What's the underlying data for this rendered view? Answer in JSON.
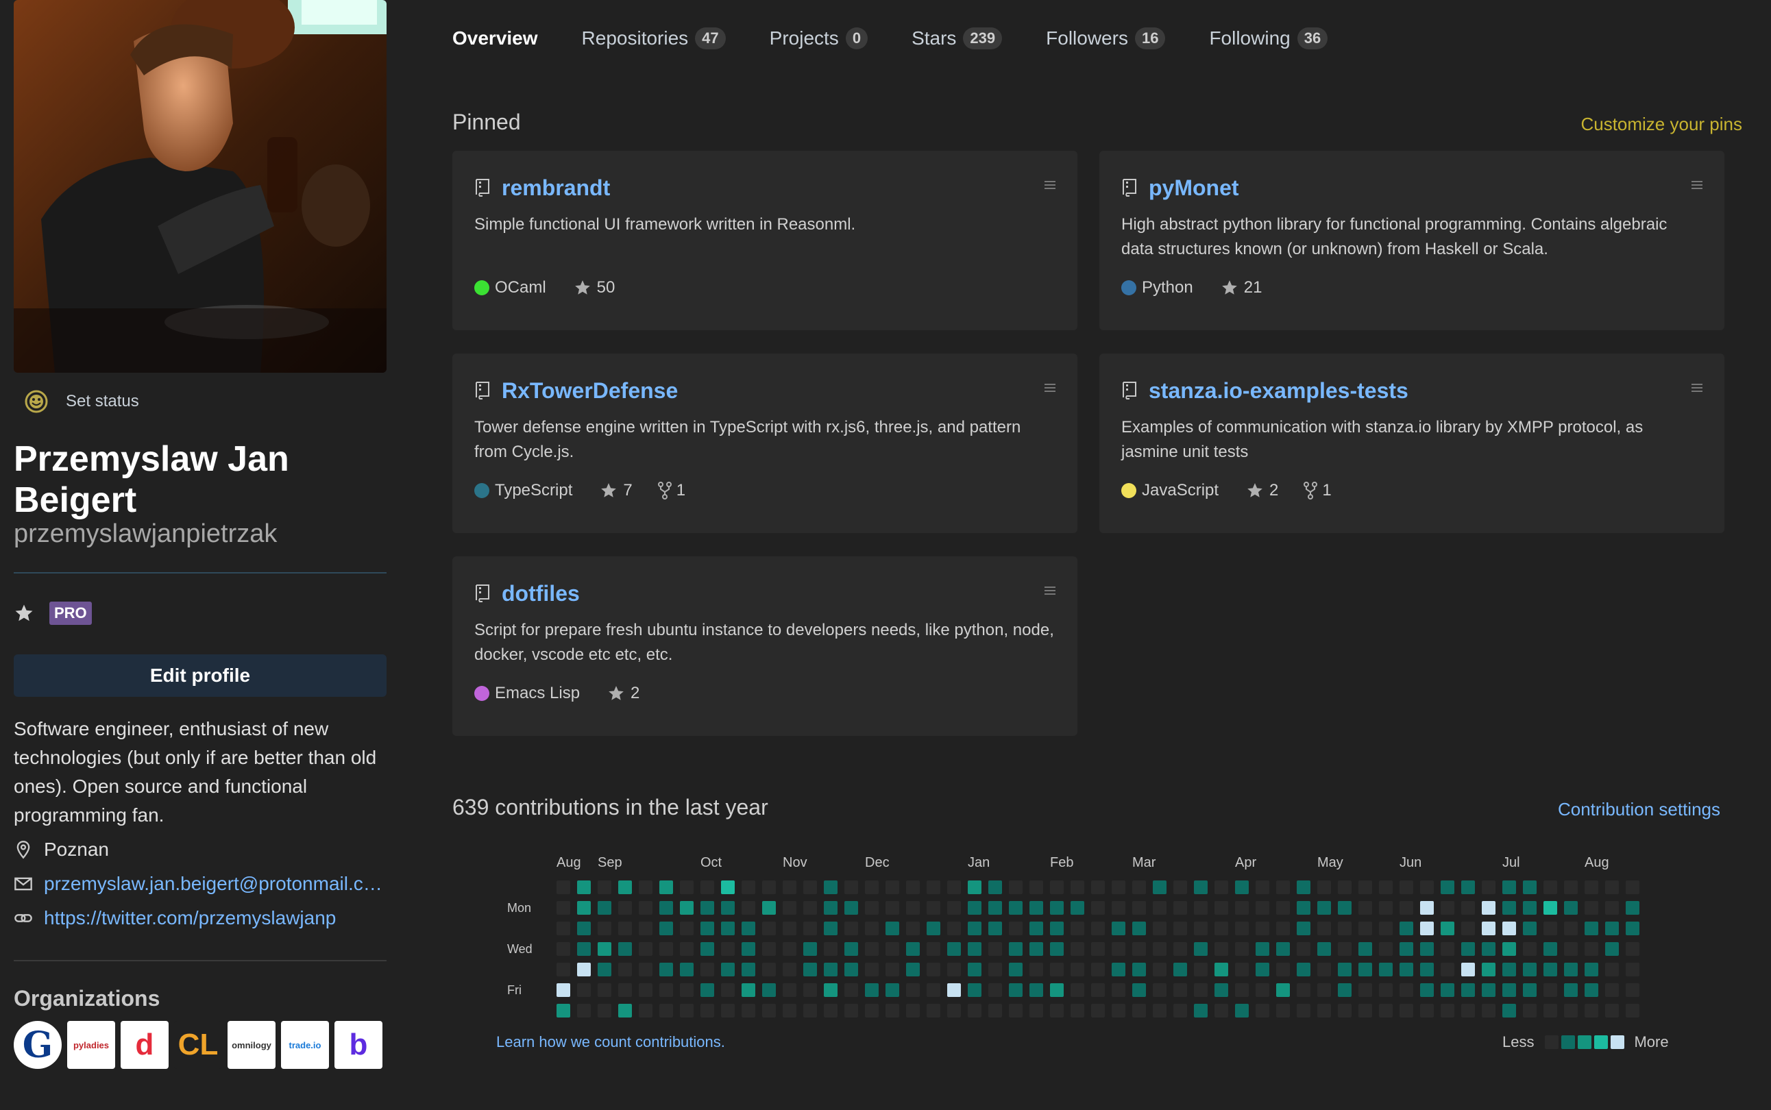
{
  "profile": {
    "set_status": "Set status",
    "full_name": "Przemyslaw Jan Beigert",
    "username": "przemyslawjanpietrzak",
    "pro_label": "PRO",
    "edit_profile": "Edit profile",
    "bio": "Software engineer, enthusiast of new technologies (but only if are better than old ones). Open source and functional programming fan.",
    "location": "Poznan",
    "email": "przemyslaw.jan.beigert@protonmail.com",
    "website": "https://twitter.com/przemyslawjanp"
  },
  "organizations": {
    "title": "Organizations",
    "items": [
      {
        "name": "G",
        "bg": "#ffffff",
        "fg": "#0b3a8a"
      },
      {
        "name": "pyladies",
        "bg": "#ffffff",
        "fg": "#c0262c"
      },
      {
        "name": "d",
        "bg": "#ffffff",
        "fg": "#e52b3b"
      },
      {
        "name": "CL",
        "bg": "#212121",
        "fg": "#f0a42a"
      },
      {
        "name": "omnilogy",
        "bg": "#ffffff",
        "fg": "#333333"
      },
      {
        "name": "trade.io",
        "bg": "#ffffff",
        "fg": "#1a7ad8"
      },
      {
        "name": "b",
        "bg": "#ffffff",
        "fg": "#5d2be0"
      }
    ]
  },
  "tabs": [
    {
      "label": "Overview",
      "count": null,
      "active": true
    },
    {
      "label": "Repositories",
      "count": "47"
    },
    {
      "label": "Projects",
      "count": "0"
    },
    {
      "label": "Stars",
      "count": "239"
    },
    {
      "label": "Followers",
      "count": "16"
    },
    {
      "label": "Following",
      "count": "36"
    }
  ],
  "pinned": {
    "title": "Pinned",
    "customize": "Customize your pins",
    "repos": [
      {
        "name": "rembrandt",
        "desc": "Simple functional UI framework written in Reasonml.",
        "lang": "OCaml",
        "lang_color": "#3be133",
        "stars": "50",
        "forks": null
      },
      {
        "name": "pyMonet",
        "desc": "High abstract python library for functional programming. Contains algebraic data structures known (or unknown) from Haskell or Scala.",
        "lang": "Python",
        "lang_color": "#3572A5",
        "stars": "21",
        "forks": null
      },
      {
        "name": "RxTowerDefense",
        "desc": "Tower defense engine written in TypeScript with rx.js6, three.js, and pattern from Cycle.js.",
        "lang": "TypeScript",
        "lang_color": "#2b7489",
        "stars": "7",
        "forks": "1"
      },
      {
        "name": "stanza.io-examples-tests",
        "desc": "Examples of communication with stanza.io library by XMPP protocol, as jasmine unit tests",
        "lang": "JavaScript",
        "lang_color": "#f1e05a",
        "stars": "2",
        "forks": "1"
      },
      {
        "name": "dotfiles",
        "desc": "Script for prepare fresh ubuntu instance to developers needs, like python, node, docker, vscode etc etc, etc.",
        "lang": "Emacs Lisp",
        "lang_color": "#c065db",
        "stars": "2",
        "forks": null
      }
    ]
  },
  "contributions": {
    "title": "639 contributions in the last year",
    "settings": "Contribution settings",
    "learn": "Learn how we count contributions.",
    "less": "Less",
    "more": "More",
    "months": [
      {
        "label": "Aug",
        "week": 0
      },
      {
        "label": "Sep",
        "week": 2
      },
      {
        "label": "Oct",
        "week": 7
      },
      {
        "label": "Nov",
        "week": 11
      },
      {
        "label": "Dec",
        "week": 15
      },
      {
        "label": "Jan",
        "week": 20
      },
      {
        "label": "Feb",
        "week": 24
      },
      {
        "label": "Mar",
        "week": 28
      },
      {
        "label": "Apr",
        "week": 33
      },
      {
        "label": "May",
        "week": 37
      },
      {
        "label": "Jun",
        "week": 41
      },
      {
        "label": "Jul",
        "week": 46
      },
      {
        "label": "Aug",
        "week": 50
      }
    ],
    "day_labels": [
      {
        "label": "Mon",
        "row": 1
      },
      {
        "label": "Wed",
        "row": 3
      },
      {
        "label": "Fri",
        "row": 5
      }
    ],
    "level_colors": [
      "#2b2b2b",
      "#0e6e64",
      "#14957f",
      "#1cbca0",
      "#c8e2f2"
    ],
    "weeks": [
      [
        0,
        0,
        0,
        0,
        0,
        4,
        2
      ],
      [
        2,
        2,
        1,
        1,
        4,
        0,
        0
      ],
      [
        0,
        1,
        0,
        2,
        1,
        0,
        0
      ],
      [
        2,
        0,
        0,
        1,
        0,
        0,
        2
      ],
      [
        0,
        0,
        0,
        0,
        0,
        0,
        0
      ],
      [
        2,
        1,
        1,
        0,
        1,
        0,
        0
      ],
      [
        0,
        2,
        0,
        0,
        1,
        0,
        0
      ],
      [
        0,
        1,
        1,
        1,
        0,
        1,
        0
      ],
      [
        3,
        1,
        1,
        0,
        1,
        0,
        0
      ],
      [
        0,
        0,
        1,
        1,
        1,
        2,
        0
      ],
      [
        0,
        2,
        0,
        0,
        0,
        1,
        0
      ],
      [
        0,
        0,
        0,
        0,
        0,
        0,
        0
      ],
      [
        0,
        0,
        0,
        1,
        1,
        0,
        0
      ],
      [
        1,
        1,
        1,
        0,
        1,
        2,
        0
      ],
      [
        0,
        1,
        0,
        1,
        1,
        0,
        0
      ],
      [
        0,
        0,
        0,
        0,
        0,
        1,
        0
      ],
      [
        0,
        0,
        1,
        0,
        0,
        1,
        0
      ],
      [
        0,
        0,
        0,
        1,
        1,
        0,
        0
      ],
      [
        0,
        0,
        1,
        0,
        0,
        0,
        0
      ],
      [
        0,
        0,
        0,
        1,
        0,
        4,
        0
      ],
      [
        2,
        1,
        1,
        1,
        1,
        1,
        0
      ],
      [
        1,
        1,
        1,
        0,
        0,
        0,
        0
      ],
      [
        0,
        1,
        0,
        1,
        1,
        1,
        0
      ],
      [
        0,
        1,
        1,
        1,
        0,
        1,
        0
      ],
      [
        0,
        1,
        1,
        1,
        0,
        2,
        0
      ],
      [
        0,
        1,
        0,
        0,
        0,
        0,
        0
      ],
      [
        0,
        0,
        0,
        0,
        0,
        0,
        0
      ],
      [
        0,
        0,
        1,
        0,
        1,
        0,
        0
      ],
      [
        0,
        0,
        1,
        0,
        1,
        1,
        0
      ],
      [
        1,
        0,
        0,
        0,
        0,
        0,
        0
      ],
      [
        0,
        0,
        0,
        0,
        1,
        0,
        0
      ],
      [
        1,
        0,
        0,
        1,
        0,
        0,
        1
      ],
      [
        0,
        0,
        0,
        0,
        2,
        1,
        0
      ],
      [
        1,
        0,
        0,
        0,
        0,
        0,
        1
      ],
      [
        0,
        0,
        0,
        1,
        1,
        0,
        0
      ],
      [
        0,
        0,
        0,
        1,
        0,
        2,
        0
      ],
      [
        1,
        1,
        1,
        0,
        1,
        0,
        0
      ],
      [
        0,
        1,
        0,
        1,
        0,
        0,
        0
      ],
      [
        0,
        1,
        0,
        0,
        1,
        1,
        0
      ],
      [
        0,
        0,
        0,
        1,
        1,
        0,
        0
      ],
      [
        0,
        0,
        0,
        0,
        1,
        0,
        0
      ],
      [
        0,
        0,
        1,
        1,
        1,
        0,
        0
      ],
      [
        0,
        4,
        4,
        1,
        1,
        1,
        0
      ],
      [
        1,
        0,
        2,
        0,
        0,
        1,
        0
      ],
      [
        1,
        0,
        0,
        1,
        4,
        1,
        0
      ],
      [
        0,
        4,
        4,
        1,
        2,
        1,
        0
      ],
      [
        1,
        1,
        4,
        2,
        1,
        1,
        1
      ],
      [
        1,
        1,
        1,
        0,
        1,
        1,
        0
      ],
      [
        0,
        3,
        0,
        1,
        1,
        0,
        0
      ],
      [
        0,
        1,
        0,
        0,
        1,
        1,
        0
      ],
      [
        0,
        0,
        1,
        0,
        1,
        1,
        0
      ],
      [
        0,
        0,
        1,
        1,
        0,
        0,
        0
      ],
      [
        0,
        1,
        1,
        0,
        0,
        0,
        0
      ]
    ]
  }
}
